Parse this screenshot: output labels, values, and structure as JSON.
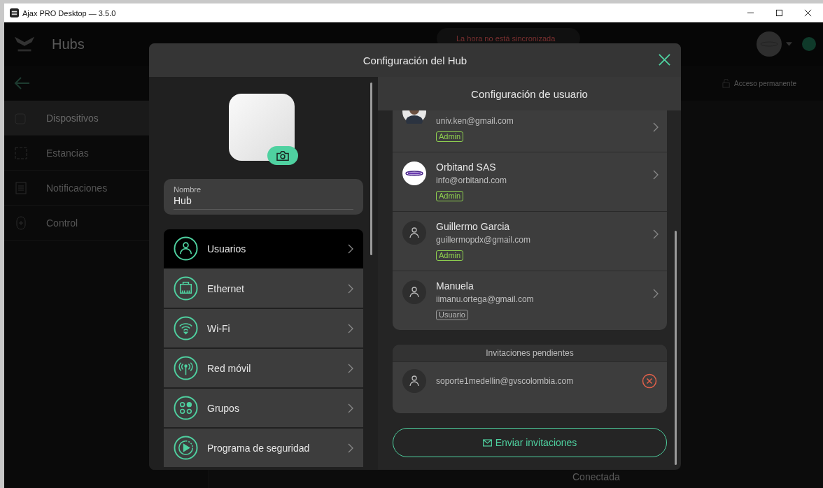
{
  "window": {
    "title": "Ajax PRO Desktop — 3.5.0"
  },
  "background": {
    "header_title": "Hubs",
    "notice": "La hora no está sincronizada",
    "access": "Acceso permanente",
    "status": "Conectada",
    "sidebar": [
      {
        "label": "Dispositivos",
        "kind": "device",
        "selected": true
      },
      {
        "label": "Estancias",
        "kind": "room",
        "selected": false
      },
      {
        "label": "Notificaciones",
        "kind": "list",
        "selected": false
      },
      {
        "label": "Control",
        "kind": "control",
        "selected": false
      }
    ]
  },
  "dialog": {
    "title": "Configuración del Hub",
    "name_field": {
      "label": "Nombre",
      "value": "Hub"
    },
    "menu": [
      {
        "label": "Usuarios",
        "kind": "user",
        "selected": true
      },
      {
        "label": "Ethernet",
        "kind": "ethernet",
        "selected": false
      },
      {
        "label": "Wi-Fi",
        "kind": "wifi",
        "selected": false
      },
      {
        "label": "Red móvil",
        "kind": "cellular",
        "selected": false
      },
      {
        "label": "Grupos",
        "kind": "groups",
        "selected": false
      },
      {
        "label": "Programa de seguridad",
        "kind": "schedule",
        "selected": false
      }
    ],
    "panel_title": "Configuración de usuario",
    "users": [
      {
        "email": "univ.ken@gmail.com",
        "role": {
          "label": "Admin",
          "kind": "admin"
        }
      },
      {
        "kind": "logo",
        "name": "Orbitand SAS",
        "email": "info@orbitand.com",
        "role": {
          "label": "Admin",
          "kind": "admin"
        }
      },
      {
        "kind": "default",
        "name": "Guillermo Garcia",
        "email": "guillermopdx@gmail.com",
        "role": {
          "label": "Admin",
          "kind": "admin"
        }
      },
      {
        "kind": "default",
        "name": "Manuela",
        "email": "iimanu.ortega@gmail.com",
        "role": {
          "label": "Usuario",
          "kind": "user"
        }
      }
    ],
    "pending": {
      "title": "Invitaciones pendientes",
      "items": [
        {
          "email": "soporte1medellin@gvscolombia.com"
        }
      ]
    },
    "send_button": "Enviar invitaciones"
  }
}
